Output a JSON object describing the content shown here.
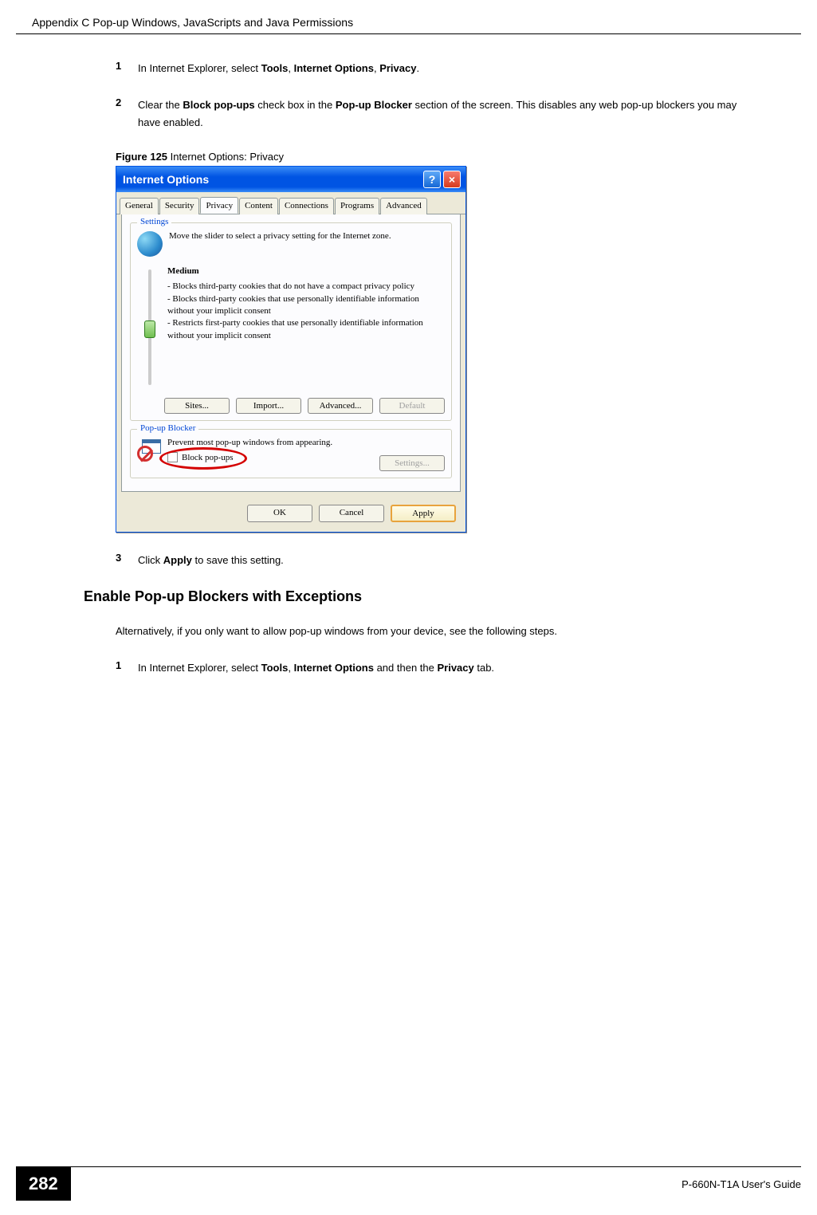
{
  "header": {
    "appendix_title": "Appendix C Pop-up Windows, JavaScripts and Java Permissions"
  },
  "steps": {
    "s1_num": "1",
    "s1_a": "In Internet Explorer, select ",
    "s1_tools": "Tools",
    "s1_comma1": ", ",
    "s1_io": "Internet Options",
    "s1_comma2": ", ",
    "s1_priv": "Privacy",
    "s1_period": ".",
    "s2_num": "2",
    "s2_a": "Clear the ",
    "s2_b1": "Block pop-ups",
    "s2_b": " check box in the ",
    "s2_b2": "Pop-up Blocker",
    "s2_c": " section of the screen. This disables any web pop-up blockers you may have enabled.",
    "s3_num": "3",
    "s3_a": "Click ",
    "s3_b": "Apply",
    "s3_c": " to save this setting."
  },
  "figure": {
    "label": "Figure 125",
    "caption": "   Internet Options: Privacy"
  },
  "dialog": {
    "title": "Internet Options",
    "tabs": {
      "general": "General",
      "security": "Security",
      "privacy": "Privacy",
      "content": "Content",
      "connections": "Connections",
      "programs": "Programs",
      "advanced": "Advanced"
    },
    "settings_group": "Settings",
    "settings_text": "Move the slider to select a privacy setting for the Internet zone.",
    "level": "Medium",
    "desc": "- Blocks third-party cookies that do not have a compact privacy policy\n- Blocks third-party cookies that use personally identifiable information without your implicit consent\n- Restricts first-party cookies that use personally identifiable information without your implicit consent",
    "btn_sites": "Sites...",
    "btn_import": "Import...",
    "btn_advanced": "Advanced...",
    "btn_default": "Default",
    "popup_group": "Pop-up Blocker",
    "popup_text": "Prevent most pop-up windows from appearing.",
    "chk_label": "Block pop-ups",
    "btn_settings": "Settings...",
    "btn_ok": "OK",
    "btn_cancel": "Cancel",
    "btn_apply": "Apply"
  },
  "section2": {
    "heading": "Enable Pop-up Blockers with Exceptions",
    "para": "Alternatively, if you only want to allow pop-up windows from your device, see the following steps.",
    "s1_num": "1",
    "s1_a": "In Internet Explorer, select ",
    "s1_tools": "Tools",
    "s1_comma": ", ",
    "s1_io": "Internet Options",
    "s1_and": " and then the ",
    "s1_priv": "Privacy",
    "s1_tab": " tab."
  },
  "footer": {
    "page": "282",
    "guide": "P-660N-T1A User's Guide"
  }
}
